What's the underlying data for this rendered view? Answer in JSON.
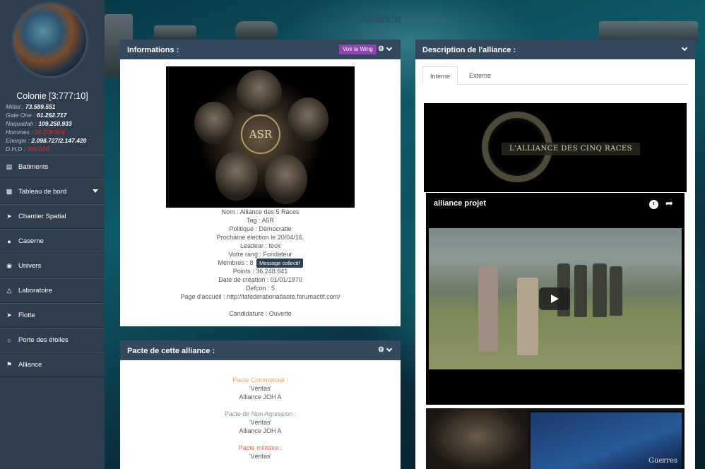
{
  "sidebar": {
    "colony_title": "Colonie [3:777:10]",
    "resources": [
      {
        "label": "Métal :",
        "value": "73.589.551",
        "alert": false
      },
      {
        "label": "Gate One :",
        "value": "61.262.717",
        "alert": false
      },
      {
        "label": "Naquadah :",
        "value": "109.250.933",
        "alert": false
      },
      {
        "label": "Hommes :",
        "value": "26.208.604",
        "alert": true
      },
      {
        "label": "Energie :",
        "value": "2.098.727/2.147.420",
        "alert": false
      },
      {
        "label": "D.H.D :",
        "value": "300.000",
        "alert": true
      }
    ],
    "menu": [
      {
        "label": "Batiments",
        "icon": "building-icon"
      },
      {
        "label": "Tableau de bord",
        "icon": "bar-chart-icon",
        "has_dropdown": true
      },
      {
        "label": "Chantier Spatial",
        "icon": "plane-icon"
      },
      {
        "label": "Caserne",
        "icon": "bomb-icon"
      },
      {
        "label": "Univers",
        "icon": "globe-icon"
      },
      {
        "label": "Laboratoire",
        "icon": "flask-icon"
      },
      {
        "label": "Flotte",
        "icon": "plane-icon"
      },
      {
        "label": "Porte des étoiles",
        "icon": "circle-icon"
      },
      {
        "label": "Alliance",
        "icon": "flag-icon"
      }
    ]
  },
  "heading": {
    "main": "Alliance",
    "sub": "Informations"
  },
  "info_panel": {
    "title": "Informations :",
    "wing_button": "Voir la Wing",
    "logo_text": "ASR",
    "name": "Nom : Alliance des 5 Races",
    "tag": "Tag : A5R",
    "politique": "Politique : Démocratie",
    "election": "Prochaine élection le 20/04/16.",
    "leader": "Leadear : teck",
    "rank": "Votre rang : Fondateur",
    "members": "Membres : 8",
    "message_button": "Message collectif",
    "points": "Points : 36.248.641",
    "created": "Date de création : 01/01/1970",
    "defcon": "Defcon : 5",
    "homepage": "Page d'accueil : http://lafederationatlante.forumactif.com/",
    "candidature": "Candidature : Ouverte"
  },
  "pact_panel": {
    "title": "Pacte de cette alliance :",
    "commercial_title": "Pacte Commercial :",
    "commercial": [
      "'Véritas'",
      "Alliance JOH A"
    ],
    "non_aggression_title": "Pacte de Non Agression :",
    "non_aggression": [
      "'Véritas'",
      "Alliance JOH A"
    ],
    "military_title": "Pacte militaire :",
    "military": [
      "'Véritas'"
    ]
  },
  "description_panel": {
    "title": "Description de l'alliance :",
    "tabs": [
      "Interne",
      "Externe"
    ],
    "active_tab": "Interne",
    "banner_text": "L'ALLIANCE DES CINQ RACES",
    "video_title": "alliance projet",
    "thumb_text": "Guerres"
  },
  "colors": {
    "panel_header": "#34495e",
    "sidebar": "#2f3e4e",
    "wing_button": "#8e44ad",
    "alert": "#e0302a"
  }
}
